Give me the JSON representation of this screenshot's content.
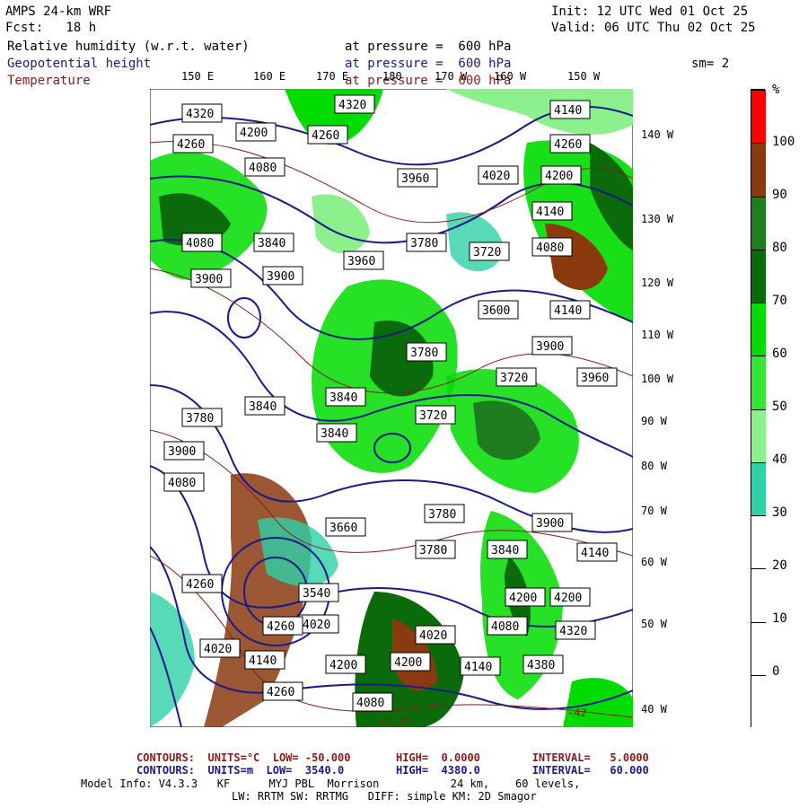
{
  "header": {
    "model": "AMPS 24-km WRF",
    "init": "Init: 12 UTC Wed 01 Oct 25",
    "fcst": "Fcst:   18 h",
    "valid": "Valid: 06 UTC Thu 02 Oct 25",
    "smoothing": "sm= 2"
  },
  "layers": [
    {
      "name": "Relative humidity (w.r.t. water)",
      "level": "at pressure =  600 hPa",
      "color": "#000000"
    },
    {
      "name": "Geopotential height",
      "level": "at pressure =  600 hPa",
      "color": "#1a1a8c"
    },
    {
      "name": "Temperature",
      "level": "at pressure =  600 hPa",
      "color": "#8b1a1a"
    }
  ],
  "lon_labels": [
    "150 E",
    "160 E",
    "170 E",
    "180",
    "170 W",
    "160 W",
    "150 W"
  ],
  "lat_labels": [
    "140 W",
    "130 W",
    "120 W",
    "110 W",
    "100 W",
    "90 W",
    "80 W",
    "70 W",
    "60 W",
    "50 W",
    "40 W"
  ],
  "colorbar": {
    "unit": "%",
    "labels": [
      "100",
      "90",
      "80",
      "70",
      "60",
      "50",
      "40",
      "30",
      "20",
      "10",
      "0"
    ],
    "bins": [
      {
        "range": "90-100+",
        "color": "#ff0000"
      },
      {
        "range": "90-100",
        "color": "#8b3a10"
      },
      {
        "range": "80-90",
        "color": "#1e7d1e"
      },
      {
        "range": "70-80",
        "color": "#0b6b0b"
      },
      {
        "range": "60-70",
        "color": "#00dc00"
      },
      {
        "range": "50-60",
        "color": "#35e535"
      },
      {
        "range": "40-50",
        "color": "#8cf08c"
      },
      {
        "range": "30-40",
        "color": "#2ed1a8"
      },
      {
        "range": "20-30",
        "color": "#ffffff"
      },
      {
        "range": "10-20",
        "color": "#ffffff"
      },
      {
        "range": "0-10",
        "color": "#ffffff"
      },
      {
        "range": "<0",
        "color": "#ffffff"
      }
    ]
  },
  "height_contour_labels": [
    "4320",
    "4140",
    "4320",
    "4260",
    "4200",
    "4260",
    "4080",
    "3960",
    "4020",
    "4200",
    "4260",
    "3840",
    "3900",
    "4140",
    "4080",
    "3960",
    "3780",
    "3720",
    "4080",
    "3900",
    "3780",
    "3600",
    "3780",
    "3900",
    "4140",
    "3720",
    "3780",
    "3840",
    "3720",
    "3960",
    "3840",
    "3780",
    "3840",
    "3900",
    "4080",
    "3660",
    "3780",
    "3780",
    "3840",
    "4140",
    "3960",
    "4020",
    "4200",
    "3900",
    "4200",
    "4260",
    "3540",
    "4080",
    "4320",
    "4020",
    "4260",
    "3960",
    "4140",
    "4200",
    "4200",
    "4140",
    "4380",
    "4020",
    "3960",
    "4260",
    "4080"
  ],
  "temp_contour_labels": [
    "-25",
    "-42",
    "-7.71"
  ],
  "footer": {
    "temp_contours": "CONTOURS:  UNITS=°C  LOW= -50.000       HIGH=  0.0000        INTERVAL=   5.0000",
    "height_contours": "CONTOURS:  UNITS=m  LOW=  3540.0        HIGH=  4380.0        INTERVAL=   60.000",
    "model_info": "Model Info: V4.3.3   KF      MYJ PBL  Morrison           24 km,    60 levels,",
    "physics": "LW: RRTM SW: RRTMG   DIFF: simple KM: 2D Smagor"
  }
}
